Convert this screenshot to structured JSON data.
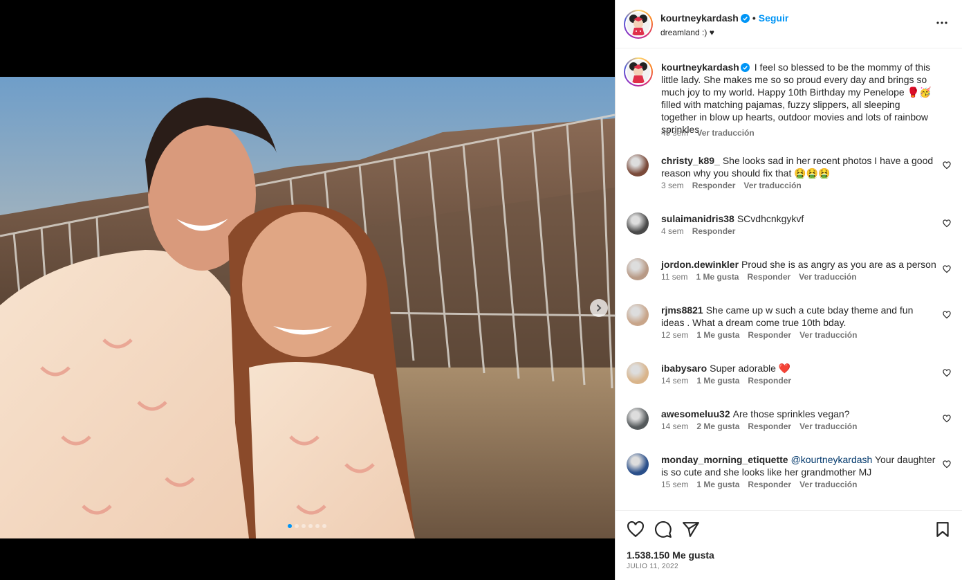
{
  "post": {
    "username": "kourtneykardash",
    "follow_label": "Seguir",
    "separator": "•",
    "location": "dreamland :) ♥",
    "caption": "I feel so blessed to be the mommy of this little lady. She makes me so so proud every day and brings so much joy to my world. Happy 10th Birthday my Penelope 🥊🥳 filled with matching pajamas, fuzzy slippers, all sleeping together in blow up hearts, outdoor movies and lots of rainbow sprinkles.",
    "caption_time": "49 sem",
    "caption_translate": "Ver traducción",
    "likes": "1.538.150 Me gusta",
    "date": "JULIO 11, 2022",
    "carousel": {
      "count": 6,
      "active_index": 0
    }
  },
  "comments": [
    {
      "username": "christy_k89_",
      "text": "She looks sad in her recent photos I have a good reason why you should fix that 🤮🤮🤮",
      "time": "3 sem",
      "likes": "",
      "reply": "Responder",
      "translate": "Ver traducción",
      "avatar_color": "#7a4a3a"
    },
    {
      "username": "sulaimanidris38",
      "text": "SCvdhcnkgykvf",
      "time": "4 sem",
      "likes": "",
      "reply": "Responder",
      "translate": "",
      "avatar_color": "#4a4a4a"
    },
    {
      "username": "jordon.dewinkler",
      "text": "Proud she is as angry as you are as a person",
      "time": "11 sem",
      "likes": "1 Me gusta",
      "reply": "Responder",
      "translate": "Ver traducción",
      "avatar_color": "#b89a86"
    },
    {
      "username": "rjms8821",
      "text": "She came up w such a cute bday theme and fun ideas . What a dream come true 10th bday.",
      "time": "12 sem",
      "likes": "1 Me gusta",
      "reply": "Responder",
      "translate": "Ver traducción",
      "avatar_color": "#c8a58a"
    },
    {
      "username": "ibabysaro",
      "text": "Super adorable ❤️",
      "time": "14 sem",
      "likes": "1 Me gusta",
      "reply": "Responder",
      "translate": "",
      "avatar_color": "#d9b48a"
    },
    {
      "username": "awesomeluu32",
      "text": "Are those sprinkles vegan?",
      "time": "14 sem",
      "likes": "2 Me gusta",
      "reply": "Responder",
      "translate": "Ver traducción",
      "avatar_color": "#555a5c"
    },
    {
      "username": "monday_morning_etiquette",
      "mention": "@kourtneykardash",
      "text": "Your daughter is so cute and she looks like her grandmother MJ",
      "time": "15 sem",
      "likes": "1 Me gusta",
      "reply": "Responder",
      "translate": "Ver traducción",
      "avatar_color": "#2a4f8a"
    }
  ],
  "colors": {
    "accent": "#0095f6",
    "verified": "#0095f6",
    "text": "#262626",
    "muted": "#737373"
  },
  "icons": [
    "verified-badge-icon",
    "more-options-icon",
    "heart-icon",
    "comment-icon",
    "share-icon",
    "save-bookmark-icon",
    "chevron-right-icon"
  ]
}
